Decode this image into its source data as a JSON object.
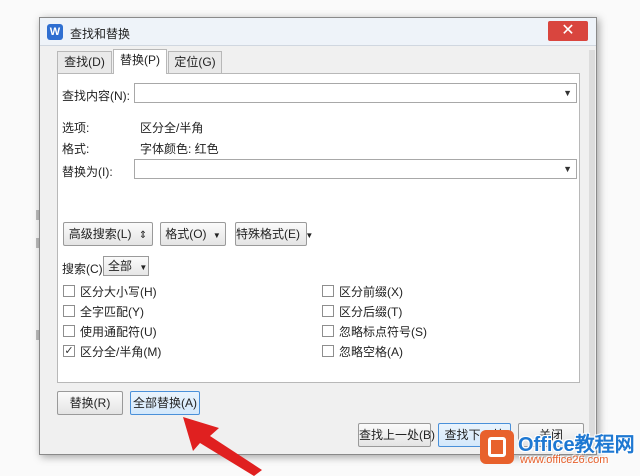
{
  "window": {
    "title": "查找和替换",
    "close_glyph": "✕",
    "app_icon": "W"
  },
  "tabs": [
    {
      "label": "查找(D)"
    },
    {
      "label": "替换(P)"
    },
    {
      "label": "定位(G)"
    }
  ],
  "find": {
    "label": "查找内容(N):",
    "value": ""
  },
  "options": {
    "label": "选项:",
    "value": "区分全/半角"
  },
  "format": {
    "label": "格式:",
    "value": "字体颜色: 红色"
  },
  "replace": {
    "label": "替换为(I):",
    "value": ""
  },
  "buttons": {
    "advanced": "高级搜索(L)",
    "advanced_icon": "⇕",
    "format": "格式(O)",
    "special": "特殊格式(E)",
    "replace": "替换(R)",
    "replace_all": "全部替换(A)",
    "find_prev": "查找上一处(B)",
    "find_next": "查找下一处",
    "close": "关闭"
  },
  "search": {
    "label": "搜索(C)",
    "value": "全部"
  },
  "checkboxes_left": [
    {
      "label": "区分大小写(H)",
      "checked": false
    },
    {
      "label": "全字匹配(Y)",
      "checked": false
    },
    {
      "label": "使用通配符(U)",
      "checked": false
    },
    {
      "label": "区分全/半角(M)",
      "checked": true
    }
  ],
  "checkboxes_right": [
    {
      "label": "区分前缀(X)",
      "checked": false
    },
    {
      "label": "区分后缀(T)",
      "checked": false
    },
    {
      "label": "忽略标点符号(S)",
      "checked": false
    },
    {
      "label": "忽略空格(A)",
      "checked": false
    }
  ],
  "watermark": {
    "title": "Office教程网",
    "subtitle": "www.office26.com"
  },
  "colors": {
    "arrow": "#e02020",
    "accent": "#4a90d9",
    "close": "#d9453e",
    "brand": "#1e78d2"
  }
}
